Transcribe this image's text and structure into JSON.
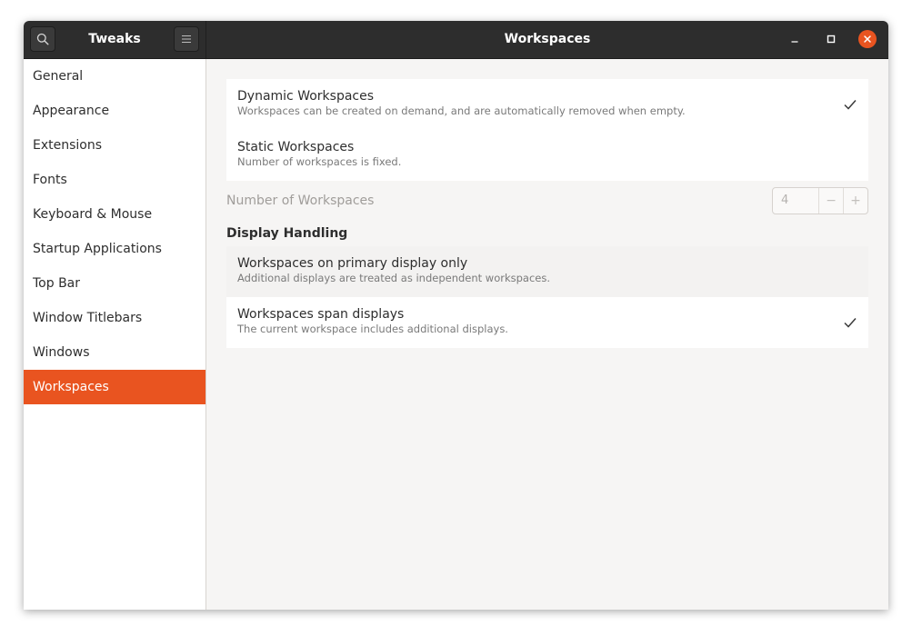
{
  "titlebar": {
    "sidebar_title": "Tweaks",
    "page_title": "Workspaces"
  },
  "sidebar": {
    "items": [
      {
        "label": "General"
      },
      {
        "label": "Appearance"
      },
      {
        "label": "Extensions"
      },
      {
        "label": "Fonts"
      },
      {
        "label": "Keyboard & Mouse"
      },
      {
        "label": "Startup Applications"
      },
      {
        "label": "Top Bar"
      },
      {
        "label": "Window Titlebars"
      },
      {
        "label": "Windows"
      },
      {
        "label": "Workspaces"
      }
    ],
    "active": "Workspaces"
  },
  "workspace_mode": {
    "options": [
      {
        "title": "Dynamic Workspaces",
        "subtitle": "Workspaces can be created on demand, and are automatically removed when empty.",
        "checked": true
      },
      {
        "title": "Static Workspaces",
        "subtitle": "Number of workspaces is fixed.",
        "checked": false
      }
    ]
  },
  "number_of_workspaces": {
    "label": "Number of Workspaces",
    "value": "4",
    "decrement": "−",
    "increment": "+"
  },
  "display_handling": {
    "heading": "Display Handling",
    "options": [
      {
        "title": "Workspaces on primary display only",
        "subtitle": "Additional displays are treated as independent workspaces.",
        "checked": false
      },
      {
        "title": "Workspaces span displays",
        "subtitle": "The current workspace includes additional displays.",
        "checked": true
      }
    ]
  },
  "colors": {
    "accent": "#e95420",
    "titlebar": "#2d2d2d"
  },
  "icons": {
    "search": "search-icon",
    "menu": "hamburger-menu-icon",
    "minimize": "minimize-icon",
    "maximize": "maximize-icon",
    "close": "close-icon",
    "check": "checkmark-icon"
  }
}
